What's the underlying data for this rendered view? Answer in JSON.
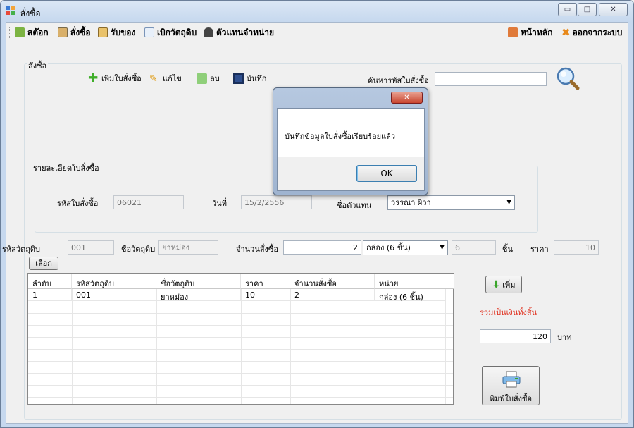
{
  "window": {
    "title": "สั่งซื้อ",
    "controls": {
      "minimize": "▭",
      "maximize": "□",
      "close": "✕"
    }
  },
  "menu": {
    "items": [
      {
        "label": "สต๊อก",
        "icon": "stock-icon"
      },
      {
        "label": "สั่งซื้อ",
        "icon": "clipboard-icon"
      },
      {
        "label": "รับของ",
        "icon": "receive-icon"
      },
      {
        "label": "เบิกวัตถุดิบ",
        "icon": "document-icon"
      },
      {
        "label": "ตัวแทนจำหน่าย",
        "icon": "person-icon"
      }
    ],
    "right": [
      {
        "label": "หน้าหลัก",
        "icon": "home-icon"
      },
      {
        "label": "ออกจากระบบ",
        "icon": "exit-icon"
      }
    ]
  },
  "order_group": {
    "label": "สั่งซื้อ",
    "toolbar": {
      "new": "เพิ่มใบสั่งซื้อ",
      "edit": "แก้ไข",
      "delete": "ลบ",
      "save": "บันทึก"
    },
    "search_label": "ค้นหารหัสใบสั่งซื้อ",
    "search_value": ""
  },
  "detail_group": {
    "label": "รายละเอียดใบสั่งซื้อ",
    "order_id_label": "รหัสใบสั่งซื้อ",
    "order_id": "06021",
    "date_label": "วันที่",
    "date": "15/2/2556",
    "agent_label": "ชื่อตัวแทน",
    "agent": "วรรณา ผิวา"
  },
  "item_entry": {
    "material_id_label": "รหัสวัตถุดิบ",
    "material_id": "001",
    "material_name_label": "ชื่อวัตถุดิบ",
    "material_name": "ยาหม่อง",
    "qty_label": "จำนวนสั่งซื้อ",
    "qty": "2",
    "unit": "กล่อง (6 ชิ้น)",
    "pieces": "6",
    "pieces_unit": "ชิ้น",
    "price_label": "ราคา",
    "price": "10",
    "select_button": "เลือก",
    "add_button": "เพิ่ม"
  },
  "grid": {
    "columns": [
      "ลำดับ",
      "รหัสวัตถุดิบ",
      "ชื่อวัตถุดิบ",
      "ราคา",
      "จำนวนสั่งซื้อ",
      "หน่วย"
    ],
    "rows": [
      [
        "1",
        "001",
        "ยาหม่อง",
        "10",
        "2",
        "กล่อง (6 ชิ้น)"
      ]
    ]
  },
  "totals": {
    "label": "รวมเป็นเงินทั้งสิ้น",
    "value": "120",
    "currency": "บาท",
    "label_color": "#e0301e"
  },
  "print_button": "พิมพ์ใบสั่งซื้อ",
  "dialog": {
    "close": "✕",
    "message": "บันทึกข้อมูลใบสั่งซื้อเรียบร้อยแล้ว",
    "ok": "OK"
  }
}
